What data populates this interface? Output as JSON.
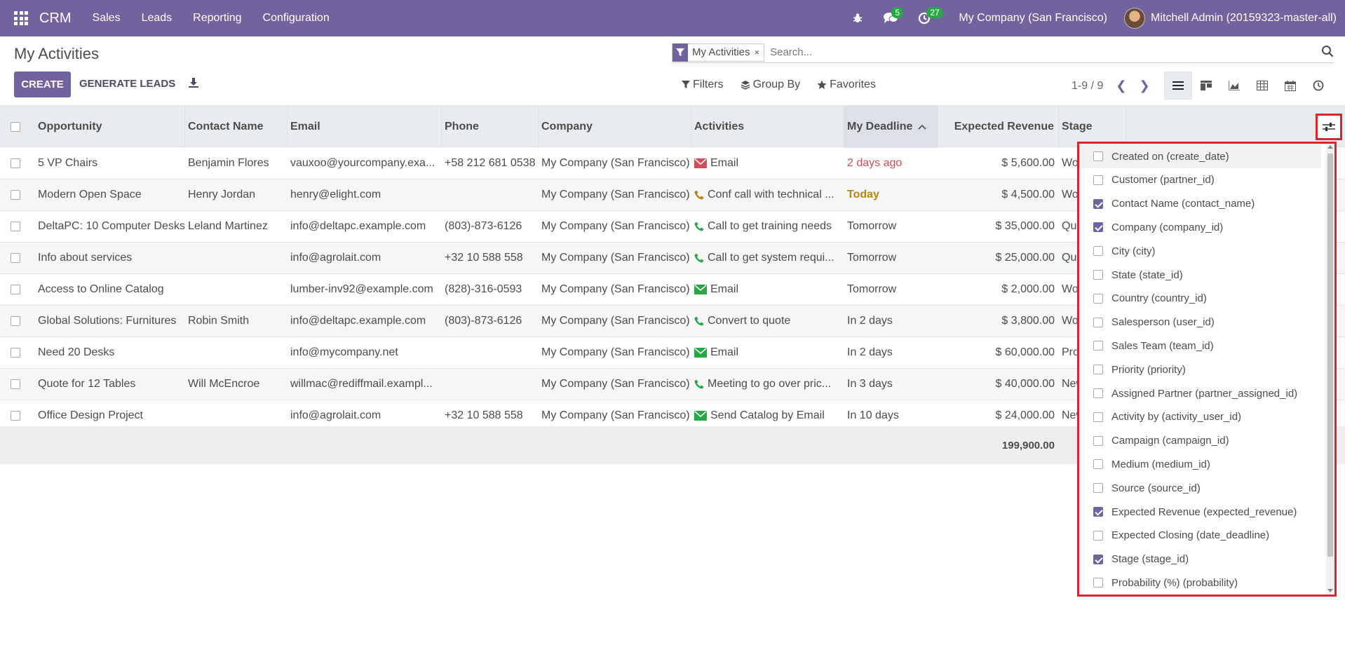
{
  "navbar": {
    "app_name": "CRM",
    "menus": [
      "Sales",
      "Leads",
      "Reporting",
      "Configuration"
    ],
    "messages_count": "5",
    "activities_count": "27",
    "company": "My Company (San Francisco)",
    "user": "Mitchell Admin (20159323-master-all)"
  },
  "control_panel": {
    "title": "My Activities",
    "facet_label": "My Activities",
    "facet_close": "×",
    "search_placeholder": "Search...",
    "create_label": "CREATE",
    "generate_label": "GENERATE LEADS",
    "filters_label": "Filters",
    "groupby_label": "Group By",
    "favorites_label": "Favorites",
    "pager": "1-9 / 9"
  },
  "table": {
    "headers": {
      "opportunity": "Opportunity",
      "contact": "Contact Name",
      "email": "Email",
      "phone": "Phone",
      "company": "Company",
      "activities": "Activities",
      "deadline": "My Deadline",
      "revenue": "Expected Revenue",
      "stage": "Stage"
    },
    "rows": [
      {
        "opportunity": "5 VP Chairs",
        "contact": "Benjamin Flores",
        "email": "vauxoo@yourcompany.exa...",
        "phone": "+58 212 681 0538",
        "company": "My Company (San Francisco)",
        "activity_icon": "envelope-icon",
        "activity": "Email",
        "deadline": "2 days ago",
        "deadline_status": "overdue",
        "revenue": "$ 5,600.00",
        "stage": "Won"
      },
      {
        "opportunity": "Modern Open Space",
        "contact": "Henry Jordan",
        "email": "henry@elight.com",
        "phone": "",
        "company": "My Company (San Francisco)",
        "activity_icon": "phone-icon",
        "activity": "Conf call with technical ...",
        "deadline": "Today",
        "deadline_status": "today",
        "revenue": "$ 4,500.00",
        "stage": "Won"
      },
      {
        "opportunity": "DeltaPC: 10 Computer Desks",
        "contact": "Leland Martinez",
        "email": "info@deltapc.example.com",
        "phone": "(803)-873-6126",
        "company": "My Company (San Francisco)",
        "activity_icon": "phone-icon",
        "activity": "Call to get training needs",
        "deadline": "Tomorrow",
        "deadline_status": "planned",
        "revenue": "$ 35,000.00",
        "stage": "Qualified"
      },
      {
        "opportunity": "Info about services",
        "contact": "",
        "email": "info@agrolait.com",
        "phone": "+32 10 588 558",
        "company": "My Company (San Francisco)",
        "activity_icon": "phone-icon",
        "activity": "Call to get system requi...",
        "deadline": "Tomorrow",
        "deadline_status": "planned",
        "revenue": "$ 25,000.00",
        "stage": "Qualified"
      },
      {
        "opportunity": "Access to Online Catalog",
        "contact": "",
        "email": "lumber-inv92@example.com",
        "phone": "(828)-316-0593",
        "company": "My Company (San Francisco)",
        "activity_icon": "envelope-icon",
        "activity": "Email",
        "deadline": "Tomorrow",
        "deadline_status": "planned",
        "revenue": "$ 2,000.00",
        "stage": "Won"
      },
      {
        "opportunity": "Global Solutions: Furnitures",
        "contact": "Robin Smith",
        "email": "info@deltapc.example.com",
        "phone": "(803)-873-6126",
        "company": "My Company (San Francisco)",
        "activity_icon": "phone-icon",
        "activity": "Convert to quote",
        "deadline": "In 2 days",
        "deadline_status": "planned",
        "revenue": "$ 3,800.00",
        "stage": "Won"
      },
      {
        "opportunity": "Need 20 Desks",
        "contact": "",
        "email": "info@mycompany.net",
        "phone": "",
        "company": "My Company (San Francisco)",
        "activity_icon": "envelope-icon",
        "activity": "Email",
        "deadline": "In 2 days",
        "deadline_status": "planned",
        "revenue": "$ 60,000.00",
        "stage": "Proposition"
      },
      {
        "opportunity": "Quote for 12 Tables",
        "contact": "Will McEncroe",
        "email": "willmac@rediffmail.exampl...",
        "phone": "",
        "company": "My Company (San Francisco)",
        "activity_icon": "phone-icon",
        "activity": "Meeting to go over pric...",
        "deadline": "In 3 days",
        "deadline_status": "planned",
        "revenue": "$ 40,000.00",
        "stage": "New"
      },
      {
        "opportunity": "Office Design Project",
        "contact": "",
        "email": "info@agrolait.com",
        "phone": "+32 10 588 558",
        "company": "My Company (San Francisco)",
        "activity_icon": "envelope-icon",
        "activity": "Send Catalog by Email",
        "deadline": "In 10 days",
        "deadline_status": "planned",
        "revenue": "$ 24,000.00",
        "stage": "New"
      }
    ],
    "total_revenue": "199,900.00"
  },
  "optional_columns": [
    {
      "label": "Created on (create_date)",
      "checked": false
    },
    {
      "label": "Customer (partner_id)",
      "checked": false
    },
    {
      "label": "Contact Name (contact_name)",
      "checked": true
    },
    {
      "label": "Company (company_id)",
      "checked": true
    },
    {
      "label": "City (city)",
      "checked": false
    },
    {
      "label": "State (state_id)",
      "checked": false
    },
    {
      "label": "Country (country_id)",
      "checked": false
    },
    {
      "label": "Salesperson (user_id)",
      "checked": false
    },
    {
      "label": "Sales Team (team_id)",
      "checked": false
    },
    {
      "label": "Priority (priority)",
      "checked": false
    },
    {
      "label": "Assigned Partner (partner_assigned_id)",
      "checked": false
    },
    {
      "label": "Activity by (activity_user_id)",
      "checked": false
    },
    {
      "label": "Campaign (campaign_id)",
      "checked": false
    },
    {
      "label": "Medium (medium_id)",
      "checked": false
    },
    {
      "label": "Source (source_id)",
      "checked": false
    },
    {
      "label": "Expected Revenue (expected_revenue)",
      "checked": true
    },
    {
      "label": "Expected Closing (date_deadline)",
      "checked": false
    },
    {
      "label": "Stage (stage_id)",
      "checked": true
    },
    {
      "label": "Probability (%) (probability)",
      "checked": false
    }
  ],
  "colors": {
    "brand": "#71639e",
    "badge": "#28a745",
    "overdue": "#d44c59",
    "today": "#b8860b",
    "highlight": "#e1222c",
    "email_overdue": "#d44c59",
    "activity_green": "#28a745"
  }
}
